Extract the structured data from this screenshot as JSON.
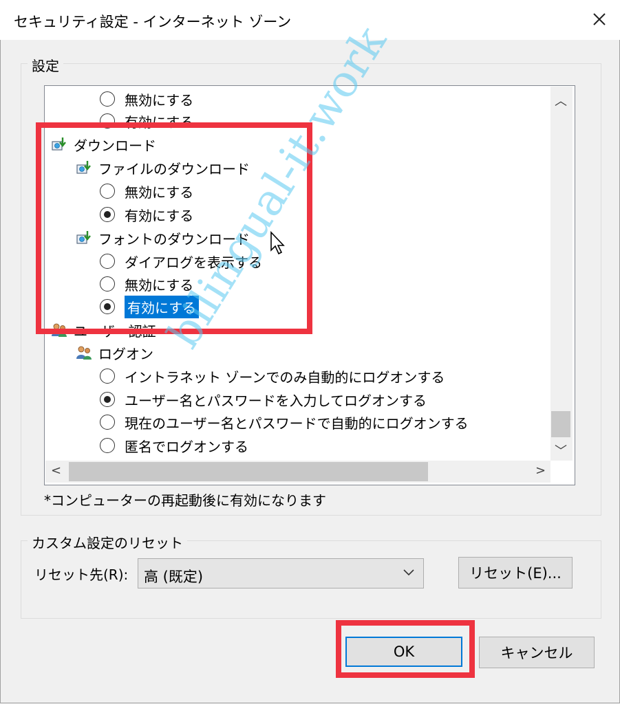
{
  "window": {
    "title": "セキュリティ設定 - インターネット ゾーン"
  },
  "settings_group": {
    "label": "設定"
  },
  "tree": {
    "rows": [
      {
        "type": "radio",
        "label": "無効にする",
        "checked": false,
        "indent": 1,
        "selected": false
      },
      {
        "type": "radio",
        "label": "有効にする",
        "checked": false,
        "indent": 1,
        "selected": false
      },
      {
        "type": "category",
        "label": "ダウンロード",
        "indent": 0,
        "icon": "download-settings-icon"
      },
      {
        "type": "category",
        "label": "ファイルのダウンロード",
        "indent": 1,
        "icon": "download-settings-icon"
      },
      {
        "type": "radio",
        "label": "無効にする",
        "checked": false,
        "indent": 1,
        "selected": false
      },
      {
        "type": "radio",
        "label": "有効にする",
        "checked": true,
        "indent": 1,
        "selected": false
      },
      {
        "type": "category",
        "label": "フォントのダウンロード",
        "indent": 1,
        "icon": "download-settings-icon"
      },
      {
        "type": "radio",
        "label": "ダイアログを表示する",
        "checked": false,
        "indent": 1,
        "selected": false
      },
      {
        "type": "radio",
        "label": "無効にする",
        "checked": false,
        "indent": 1,
        "selected": false
      },
      {
        "type": "radio",
        "label": "有効にする",
        "checked": true,
        "indent": 1,
        "selected": true
      },
      {
        "type": "category",
        "label": "ユーザー認証",
        "indent": 0,
        "icon": "user-auth-icon"
      },
      {
        "type": "category",
        "label": "ログオン",
        "indent": 1,
        "icon": "user-auth-icon"
      },
      {
        "type": "radio",
        "label": "イントラネット ゾーンでのみ自動的にログオンする",
        "checked": false,
        "indent": 1,
        "selected": false
      },
      {
        "type": "radio",
        "label": "ユーザー名とパスワードを入力してログオンする",
        "checked": true,
        "indent": 1,
        "selected": false
      },
      {
        "type": "radio",
        "label": "現在のユーザー名とパスワードで自動的にログオンする",
        "checked": false,
        "indent": 1,
        "selected": false
      },
      {
        "type": "radio",
        "label": "匿名でログオンする",
        "checked": false,
        "indent": 1,
        "selected": false
      }
    ]
  },
  "note": "*コンピューターの再起動後に有効になります",
  "reset_group": {
    "label": "カスタム設定のリセット",
    "reset_to_label": "リセット先(R):",
    "reset_to_value": "高 (既定)",
    "reset_button": "リセット(E)..."
  },
  "buttons": {
    "ok": "OK",
    "cancel": "キャンセル"
  },
  "watermark": "bilingual-it.work",
  "colors": {
    "highlight": "#ee3340",
    "selection": "#0078d7",
    "accent": "#0078d7"
  }
}
